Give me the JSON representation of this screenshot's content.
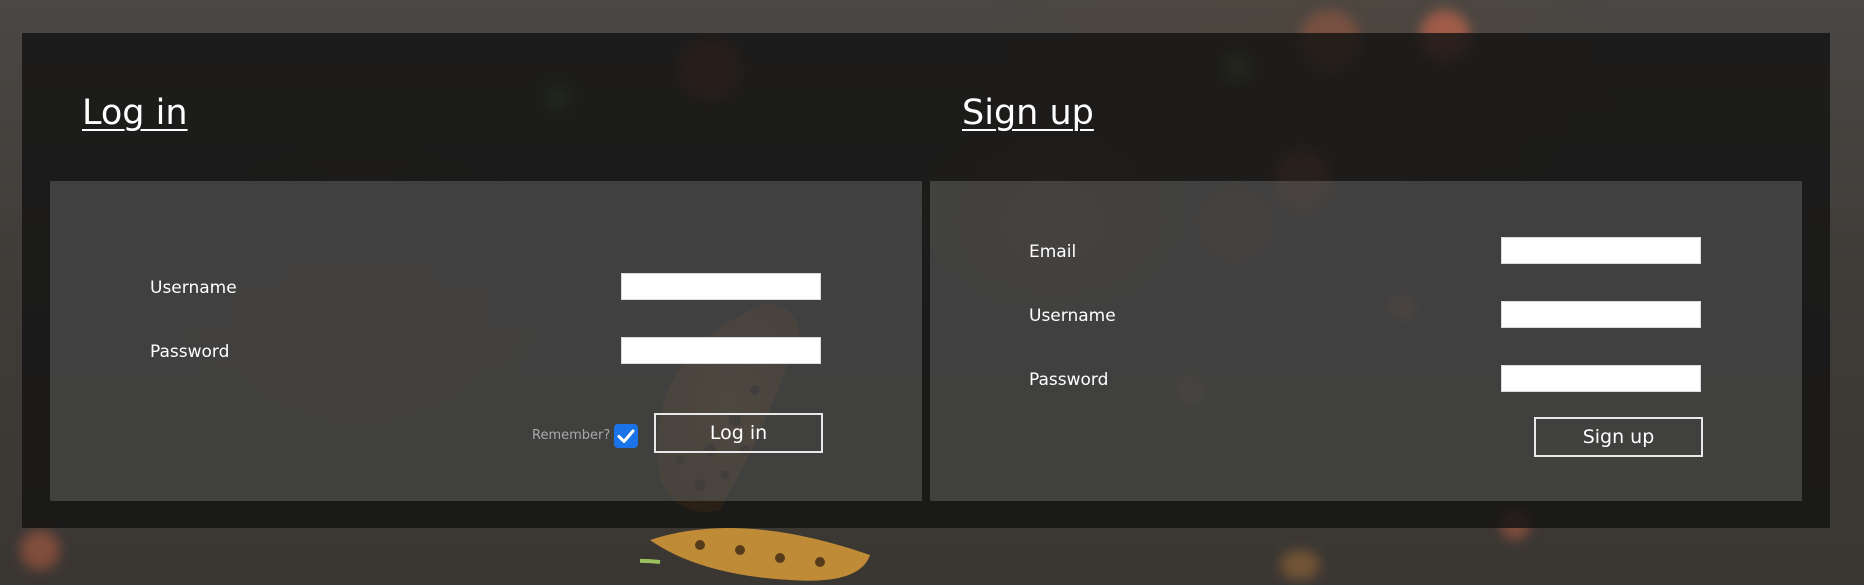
{
  "login": {
    "heading": "Log in",
    "username_label": "Username",
    "password_label": "Password",
    "remember_label": "Remember?",
    "remember_checked": true,
    "submit_label": "Log in",
    "username_value": "",
    "password_value": ""
  },
  "signup": {
    "heading": "Sign up",
    "email_label": "Email",
    "username_label": "Username",
    "password_label": "Password",
    "submit_label": "Sign up",
    "email_value": "",
    "username_value": "",
    "password_value": ""
  },
  "colors": {
    "checkbox_accent": "#1a73e8",
    "text": "#ffffff",
    "panel": "#141414"
  }
}
